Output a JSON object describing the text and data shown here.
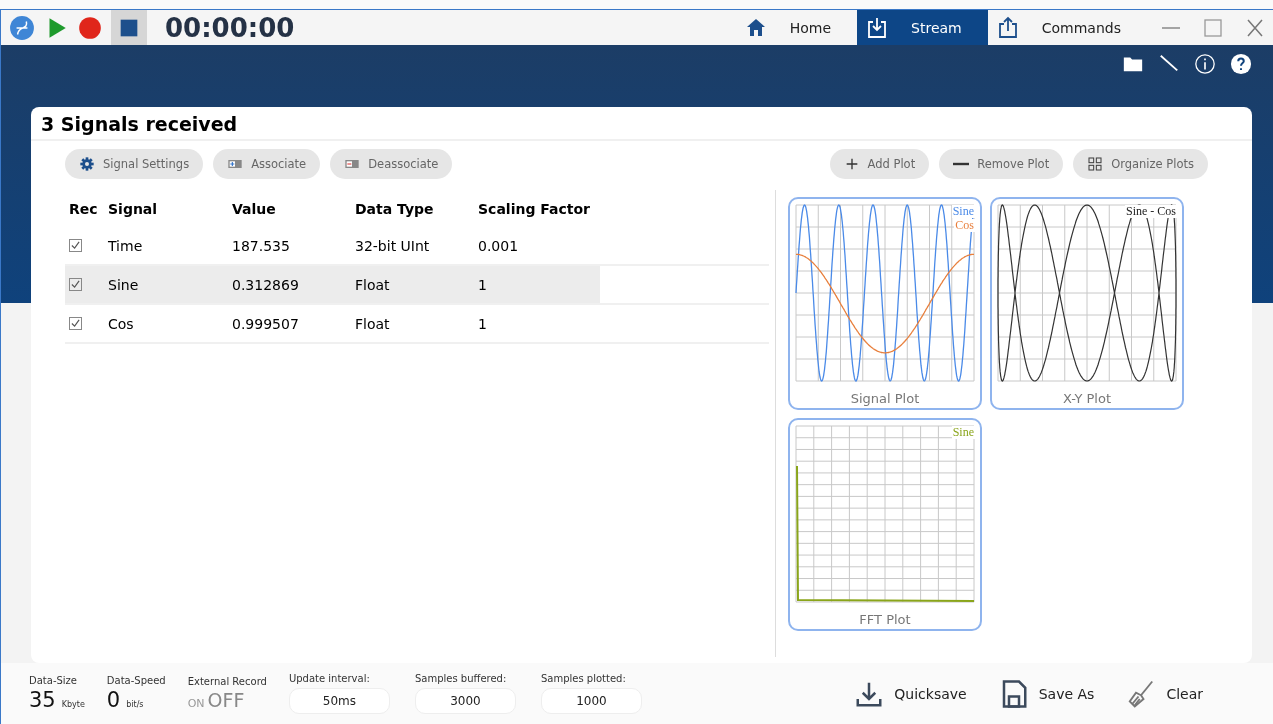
{
  "titlebar": {
    "timer": "00:00:00",
    "tabs": [
      {
        "label": "Home",
        "selected": false
      },
      {
        "label": "Stream",
        "selected": true
      },
      {
        "label": "Commands",
        "selected": false
      }
    ]
  },
  "panel": {
    "title": "3 Signals received",
    "left_actions": [
      {
        "label": "Signal Settings"
      },
      {
        "label": "Associate"
      },
      {
        "label": "Deassociate"
      }
    ],
    "right_actions": [
      {
        "label": "Add Plot"
      },
      {
        "label": "Remove Plot"
      },
      {
        "label": "Organize Plots"
      }
    ],
    "table": {
      "columns": [
        "Rec",
        "Signal",
        "Value",
        "Data Type",
        "Scaling Factor"
      ],
      "rows": [
        {
          "checked": true,
          "selected": false,
          "cells": [
            "",
            "Time",
            "187.535",
            "32-bit UInt",
            "0.001"
          ]
        },
        {
          "checked": true,
          "selected": true,
          "cells": [
            "",
            "Sine",
            "0.312869",
            "Float",
            "1"
          ]
        },
        {
          "checked": true,
          "selected": false,
          "cells": [
            "",
            "Cos",
            "0.999507",
            "Float",
            "1"
          ]
        }
      ]
    },
    "plots": [
      {
        "kind": "signal",
        "title": "Signal Plot",
        "legend": [
          {
            "text": "Sine",
            "color": "#4a8ae8"
          },
          {
            "text": "Cos",
            "color": "#e87f3c"
          }
        ]
      },
      {
        "kind": "xy",
        "title": "X-Y Plot",
        "legend": [
          {
            "text": "Sine - Cos",
            "color": "#222222"
          }
        ]
      },
      {
        "kind": "fft",
        "title": "FFT Plot",
        "legend": [
          {
            "text": "Sine",
            "color": "#8aa51a"
          }
        ]
      }
    ]
  },
  "footer": {
    "stats": [
      {
        "label": "Data-Size",
        "value": "35",
        "unit": "Kbyte"
      },
      {
        "label": "Data-Speed",
        "value": "0",
        "unit": "bit/s"
      }
    ],
    "external_record": {
      "label": "External Record",
      "on_text": "ON",
      "off_text": "OFF",
      "on": false
    },
    "fields": [
      {
        "label": "Update interval:",
        "value": "50ms"
      },
      {
        "label": "Samples buffered:",
        "value": "3000"
      },
      {
        "label": "Samples plotted:",
        "value": "1000"
      }
    ],
    "buttons": [
      {
        "label": "Quicksave"
      },
      {
        "label": "Save As"
      },
      {
        "label": "Clear"
      }
    ]
  }
}
